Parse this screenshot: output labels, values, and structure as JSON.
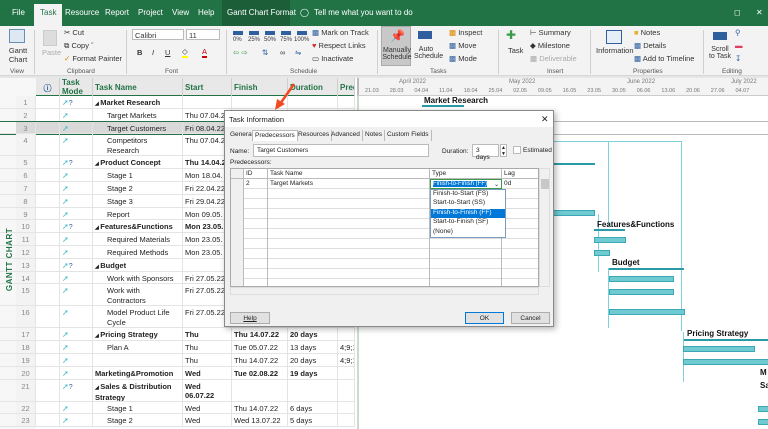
{
  "menu": {
    "tabs": [
      "File",
      "Task",
      "Resource",
      "Report",
      "Project",
      "View",
      "Help"
    ],
    "context_tab": "Gantt Chart Format",
    "tell_me": "Tell me what you want to do",
    "active": "Task"
  },
  "ribbon": {
    "view": {
      "gantt": "Gantt Chart",
      "label": "View"
    },
    "clipboard": {
      "paste": "Paste",
      "cut": "Cut",
      "copy": "Copy",
      "format_painter": "Format Painter",
      "label": "Clipboard"
    },
    "font": {
      "family": "Calibri",
      "size": "11",
      "bold": "B",
      "italic": "I",
      "underline": "U",
      "label": "Font"
    },
    "schedule": {
      "mark_on_track": "Mark on Track",
      "respect_links": "Respect Links",
      "inactivate": "Inactivate",
      "label": "Schedule",
      "pct": [
        "0%",
        "25%",
        "50%",
        "75%",
        "100%"
      ]
    },
    "tasks": {
      "manually": "Manually Schedule",
      "auto": "Auto Schedule",
      "inspect": "Inspect",
      "move": "Move",
      "mode": "Mode",
      "label": "Tasks"
    },
    "insert": {
      "task": "Task",
      "summary": "Summary",
      "milestone": "Milestone",
      "deliverable": "Deliverable",
      "label": "Insert"
    },
    "properties": {
      "information": "Information",
      "notes": "Notes",
      "details": "Details",
      "add_timeline": "Add to Timeline",
      "label": "Properties"
    },
    "editing": {
      "scroll": "Scroll to Task",
      "label": "Editing"
    }
  },
  "sidebar": {
    "label": "GANTT CHART"
  },
  "table": {
    "headers": [
      "Task Mode",
      "Task Name",
      "Start",
      "Finish",
      "Duration",
      "Pred"
    ],
    "rows": [
      {
        "id": "1",
        "mode": "auto",
        "name": "Market Research",
        "summary": true,
        "start": "",
        "finish": "",
        "duration": "",
        "pred": ""
      },
      {
        "id": "2",
        "mode": "manual",
        "name": "Target Markets",
        "start": "Thu 07.04.2",
        "finish": "",
        "duration": "",
        "pred": ""
      },
      {
        "id": "3",
        "mode": "manual",
        "name": "Target Customers",
        "start": "Fri 08.04.22",
        "finish": "",
        "duration": "",
        "pred": "",
        "selected": true
      },
      {
        "id": "4",
        "mode": "manual",
        "name": "Competitors Research",
        "start": "Thu 07.04.2",
        "finish": "",
        "duration": "",
        "pred": "",
        "dbl": true
      },
      {
        "id": "5",
        "mode": "auto",
        "name": "Product Concept",
        "summary": true,
        "start": "Thu 14.04.2",
        "finish": "",
        "duration": "",
        "pred": ""
      },
      {
        "id": "6",
        "mode": "manual",
        "name": "Stage 1",
        "start": "Mon 18.04.",
        "finish": "",
        "duration": "",
        "pred": ""
      },
      {
        "id": "7",
        "mode": "manual",
        "name": "Stage 2",
        "start": "Fri 22.04.22",
        "finish": "",
        "duration": "",
        "pred": ""
      },
      {
        "id": "8",
        "mode": "manual",
        "name": "Stage 3",
        "start": "Fri 29.04.22",
        "finish": "",
        "duration": "",
        "pred": ""
      },
      {
        "id": "9",
        "mode": "manual",
        "name": "Report",
        "start": "Mon 09.05.",
        "finish": "",
        "duration": "",
        "pred": ""
      },
      {
        "id": "10",
        "mode": "auto",
        "name": "Features&Functions",
        "summary": true,
        "start": "Mon 23.05.",
        "finish": "",
        "duration": "",
        "pred": ""
      },
      {
        "id": "11",
        "mode": "manual",
        "name": "Required Materials",
        "start": "Mon 23.05.",
        "finish": "",
        "duration": "",
        "pred": ""
      },
      {
        "id": "12",
        "mode": "manual",
        "name": "Required Methods",
        "start": "Mon 23.05.",
        "finish": "",
        "duration": "",
        "pred": ""
      },
      {
        "id": "13",
        "mode": "auto",
        "name": "Budget",
        "summary": true,
        "start": "",
        "finish": "",
        "duration": "",
        "pred": ""
      },
      {
        "id": "14",
        "mode": "manual",
        "name": "Work with Sponsors",
        "start": "Fri 27.05.22",
        "finish": "",
        "duration": "",
        "pred": ""
      },
      {
        "id": "15",
        "mode": "manual",
        "name": "Work with Contractors",
        "start": "Fri 27.05.22",
        "finish": "",
        "duration": "",
        "pred": "",
        "dbl": true
      },
      {
        "id": "16",
        "mode": "manual",
        "name": "Model Product Life Cycle",
        "start": "Fri 27.05.22",
        "finish": "",
        "duration": "",
        "pred": "",
        "dbl": true
      },
      {
        "id": "17",
        "mode": "manual",
        "name": "Pricing Strategy",
        "summary": true,
        "start": "Thu 16.06.22",
        "finish": "Thu 14.07.22",
        "duration": "20 days",
        "pred": ""
      },
      {
        "id": "18",
        "mode": "manual",
        "name": "Plan A",
        "start": "Thu 16.06.22",
        "finish": "Tue 05.07.22",
        "duration": "13 days",
        "pred": "4;9;1"
      },
      {
        "id": "19",
        "mode": "manual",
        "name": "",
        "start": "Thu 16.06.22",
        "finish": "Thu 14.07.22",
        "duration": "20 days",
        "pred": "4;9;1"
      },
      {
        "id": "20",
        "mode": "manual",
        "name": "Marketing&Promotion",
        "summary": true,
        "start": "Wed 06.07.22",
        "finish": "Tue 02.08.22",
        "duration": "19 days",
        "pred": ""
      },
      {
        "id": "21",
        "mode": "auto",
        "name": "Sales & Distribution Strategy",
        "summary": true,
        "start": "Wed 06.07.22",
        "finish": "",
        "duration": "",
        "pred": "",
        "dbl": true
      },
      {
        "id": "22",
        "mode": "manual",
        "name": "Stage 1",
        "start": "Wed 06.07.22",
        "finish": "Thu 14.07.22",
        "duration": "6 days",
        "pred": ""
      },
      {
        "id": "23",
        "mode": "manual",
        "name": "Stage 2",
        "start": "Wed 06.07.22",
        "finish": "Wed 13.07.22",
        "duration": "5 days",
        "pred": ""
      }
    ]
  },
  "timeline": {
    "months": [
      "April 2022",
      "May 2022",
      "June 2022",
      "July 2022"
    ],
    "weeks": [
      "21.03",
      "28.03",
      "04.04",
      "11.04",
      "18.04",
      "25.04",
      "02.05",
      "09.05",
      "16.05",
      "23.05",
      "30.05",
      "06.06",
      "13.06",
      "20.06",
      "27.06",
      "04.07"
    ]
  },
  "gantt": {
    "labels": [
      "Market Research",
      "Features&Functions",
      "Budget",
      "Pricing Strategy",
      "M",
      "Sa"
    ],
    "bar_color": "#6fcad2"
  },
  "dialog": {
    "title": "Task Information",
    "tabs": [
      "General",
      "Predecessors",
      "Resources",
      "Advanced",
      "Notes",
      "Custom Fields"
    ],
    "active_tab": "Predecessors",
    "name_label": "Name:",
    "name_value": "Target Customers",
    "duration_label": "Duration:",
    "duration_value": "3 days",
    "estimated_label": "Estimated",
    "estimated": false,
    "pred_label": "Predecessors:",
    "grid_headers": [
      "ID",
      "Task Name",
      "Type",
      "Lag"
    ],
    "grid_row": {
      "id": "2",
      "name": "Target Markets",
      "type": "Finish-to-Finish (FF)",
      "lag": "0d"
    },
    "type_options": [
      "Finish-to-Start (FS)",
      "Start-to-Start (SS)",
      "Finish-to-Finish (FF)",
      "Start-to-Finish (SF)",
      "(None)"
    ],
    "selected_option": "Finish-to-Finish (FF)",
    "help": "Help",
    "ok": "OK",
    "cancel": "Cancel"
  },
  "annotation": {
    "arrow_color": "#f04a23"
  }
}
